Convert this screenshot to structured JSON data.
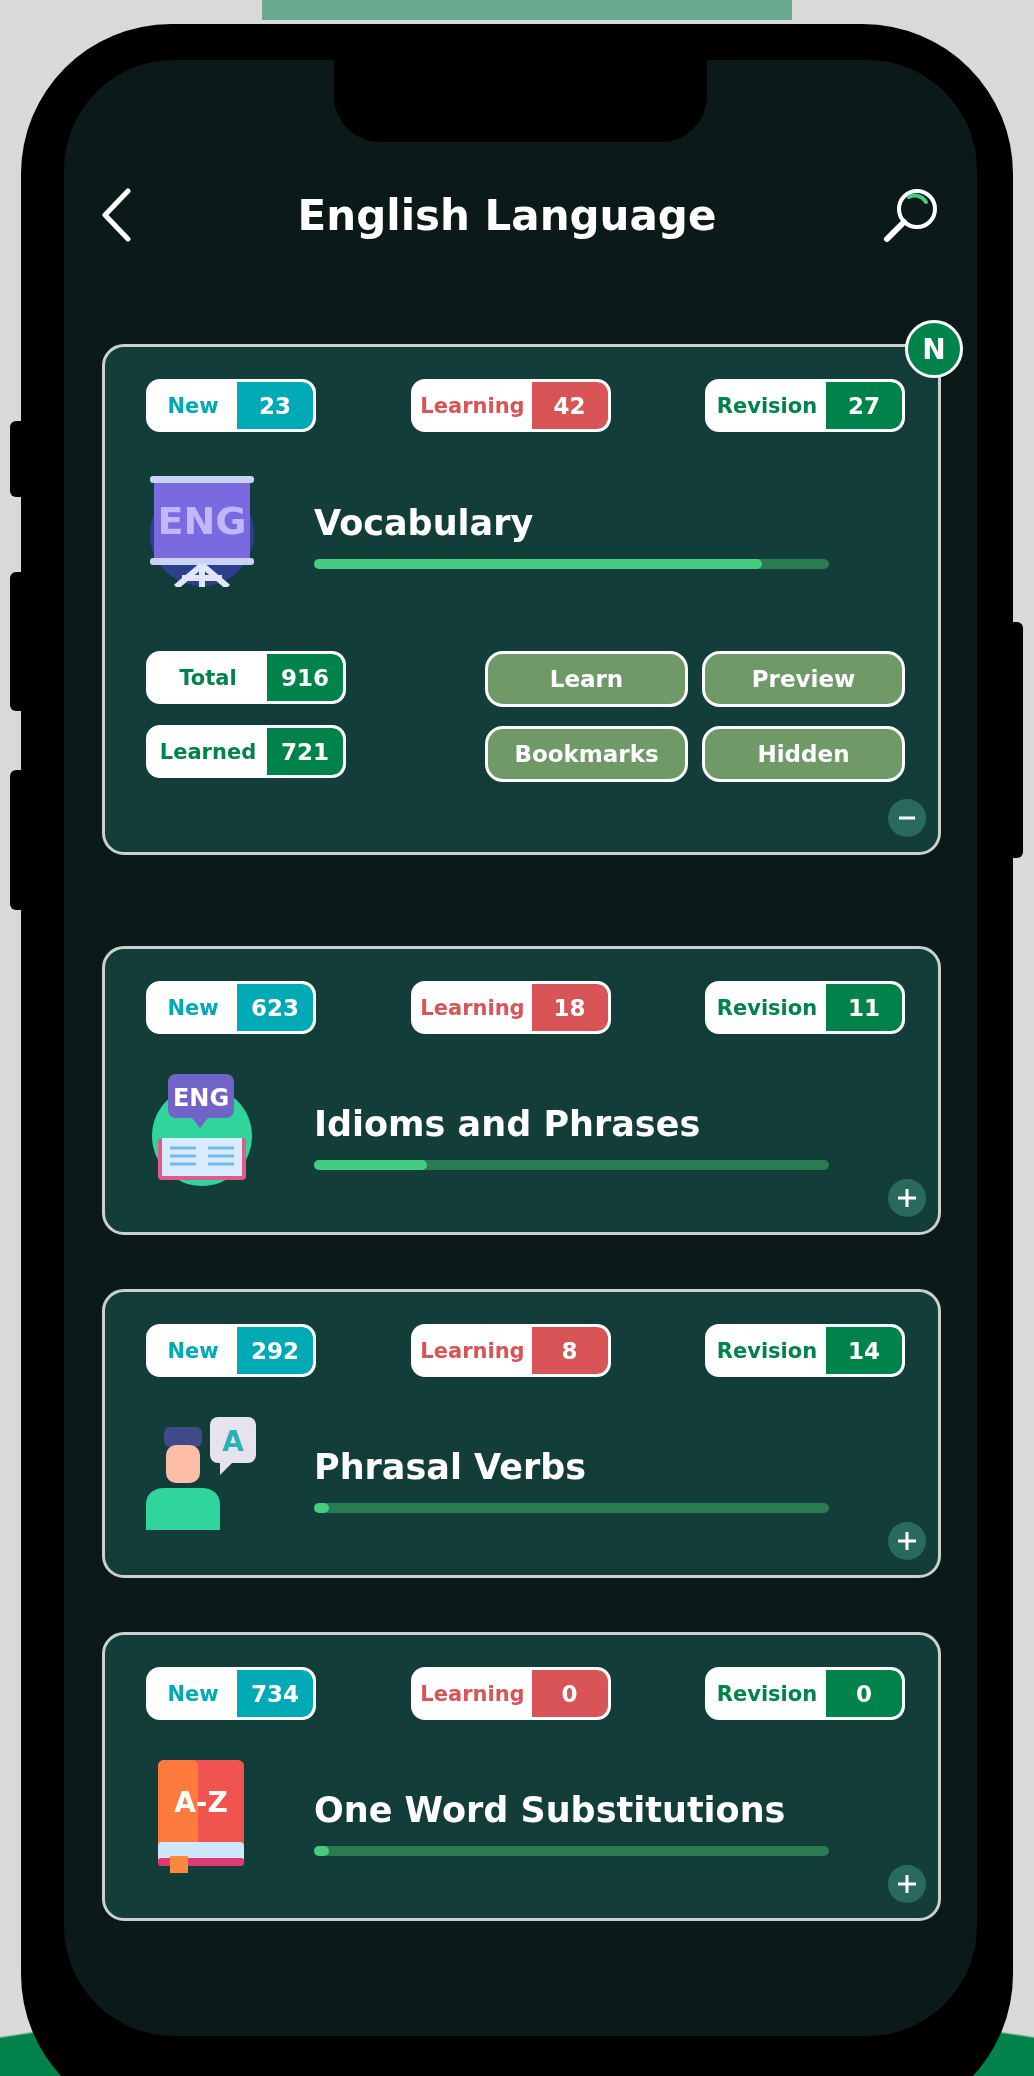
{
  "header": {
    "title": "English Language"
  },
  "cards": [
    {
      "marker": "N",
      "badges": [
        {
          "kind": "new",
          "label": "New",
          "count": "23"
        },
        {
          "kind": "learning",
          "label": "Learning",
          "count": "42"
        },
        {
          "kind": "revision",
          "label": "Revision",
          "count": "27"
        }
      ],
      "kind": "easel",
      "icon_text": "ENG",
      "title": "Vocabulary",
      "level": 0.87,
      "expanded": true,
      "stats": [
        {
          "label": "Total",
          "value": "916"
        },
        {
          "label": "Learned",
          "value": "721"
        }
      ],
      "actions": [
        "Learn",
        "Preview",
        "Bookmarks",
        "Hidden"
      ]
    },
    {
      "badges": [
        {
          "kind": "new",
          "label": "New",
          "count": "623"
        },
        {
          "kind": "learning",
          "label": "Learning",
          "count": "18"
        },
        {
          "kind": "revision",
          "label": "Revision",
          "count": "11"
        }
      ],
      "kind": "book",
      "icon_text": "ENG",
      "title": "Idioms and Phrases",
      "level": 0.22,
      "expanded": false
    },
    {
      "badges": [
        {
          "kind": "new",
          "label": "New",
          "count": "292"
        },
        {
          "kind": "learning",
          "label": "Learning",
          "count": "8"
        },
        {
          "kind": "revision",
          "label": "Revision",
          "count": "14"
        }
      ],
      "kind": "person",
      "icon_text": "A",
      "title": "Phrasal Verbs",
      "level": 0.03,
      "expanded": false
    },
    {
      "badges": [
        {
          "kind": "new",
          "label": "New",
          "count": "734"
        },
        {
          "kind": "learning",
          "label": "Learning",
          "count": "0"
        },
        {
          "kind": "revision",
          "label": "Revision",
          "count": "0"
        }
      ],
      "kind": "dictionary",
      "icon_text": "A-Z",
      "title": "One Word Substitutions",
      "level": 0.03,
      "expanded": false
    }
  ]
}
